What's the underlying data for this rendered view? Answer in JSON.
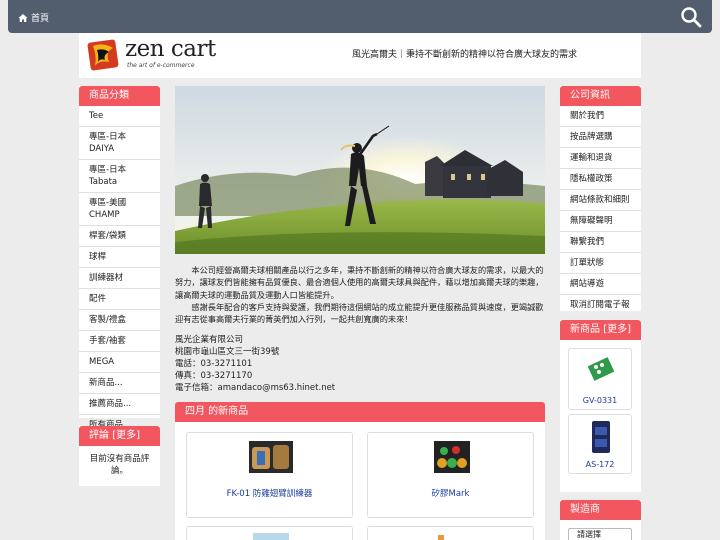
{
  "nav": {
    "home_label": "首頁"
  },
  "header": {
    "logo_main": "zen cart",
    "logo_sub": "the art of e-commerce",
    "tagline": "風光高爾夫｜秉持不斷創新的精神以符合廣大球友的需求"
  },
  "categories": {
    "title": "商品分類",
    "items": [
      "Tee",
      "專區-日本DAIYA",
      "專區-日本Tabata",
      "專區-美國CHAMP",
      "桿套/袋類",
      "球桿",
      "訓練器材",
      "配件",
      "客製/禮盒",
      "手套/袖套",
      "MEGA",
      "新商品...",
      "推薦商品...",
      "所有商品..."
    ]
  },
  "reviews": {
    "title": "評論",
    "more": "[更多]",
    "empty_text": "目前沒有商品評論。"
  },
  "info": {
    "title": "公司資訊",
    "items": [
      "關於我們",
      "按品牌選購",
      "運輸和退貨",
      "隱私權政策",
      "網站條款和細則",
      "無障礙聲明",
      "聯繫我們",
      "訂單狀態",
      "網站導遊",
      "取消訂閱電子報"
    ]
  },
  "side_new": {
    "title": "新商品",
    "more": "[更多]",
    "products": [
      {
        "name": "GV-0331"
      },
      {
        "name": "AS-172"
      }
    ]
  },
  "manufacturers": {
    "title": "製造商",
    "select_label": "請選擇"
  },
  "intro": {
    "para1": "本公司經營高爾夫球相關產品以行之多年，秉持不斷創新的精神以符合廣大球友的需求，以最大的努力，讓球友們皆能擁有品質優良、最合適個人使用的高爾夫球具與配件，藉以增加高爾夫球的樂趣，讓高爾夫球的運動品質及運動人口皆能提升。",
    "para2": "感謝長年配合的客戶支持與愛護，我們期待這個網站的成立能提升更佳服務品質與速度，更竭誠歡迎有志從事高爾夫行業的菁英們加入行列，一起共創寬廣的未來！"
  },
  "contact": {
    "company": "風光企業有限公司",
    "address": "桃園市龜山區文三一街39號",
    "phone": "電話：03-3271101",
    "fax": "傳真：03-3271170",
    "email": "電子信箱：amandaco@ms63.hinet.net"
  },
  "monthly_new": {
    "title": "四月 的新商品",
    "products": [
      {
        "name": "FK-01 防雞翅臂訓練器"
      },
      {
        "name": "矽膠Mark"
      }
    ]
  }
}
